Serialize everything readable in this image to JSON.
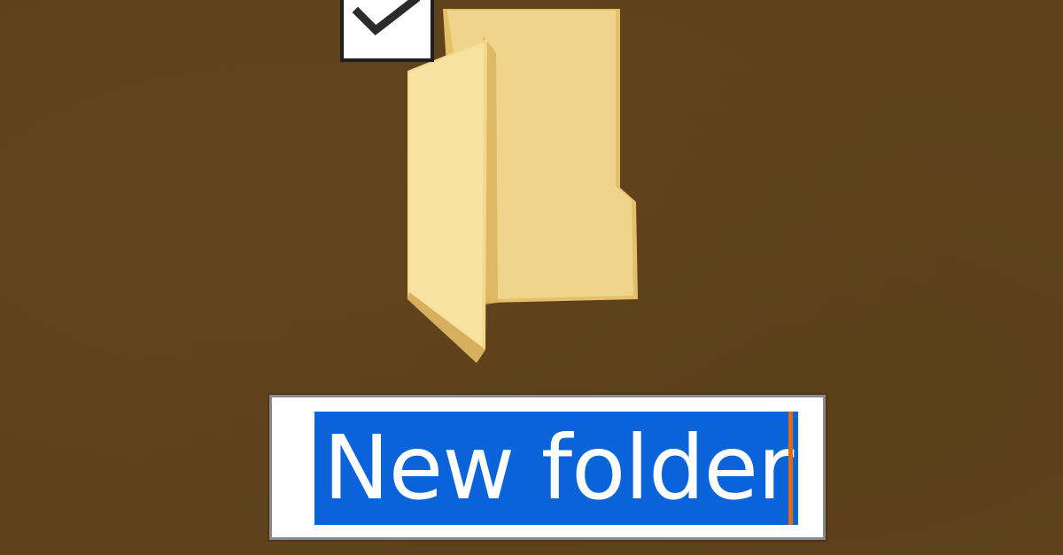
{
  "desktop": {
    "background_color": "#5f421c",
    "folder": {
      "icon": "folder-icon",
      "selected": true,
      "checkbox_icon": "checkmark-icon",
      "rename": {
        "value": "New folder",
        "selection_color": "#0a63d8",
        "caret_color": "#e06a16"
      }
    }
  }
}
